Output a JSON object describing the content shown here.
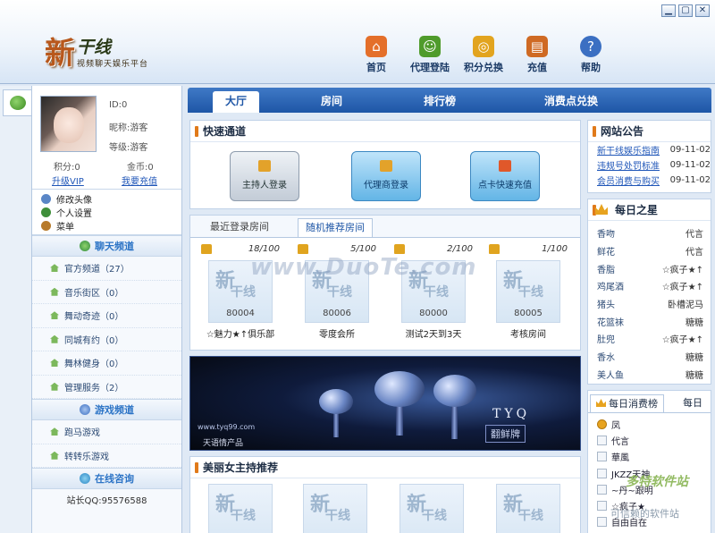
{
  "window": {
    "controls": [
      "▁",
      "▢",
      "✕"
    ]
  },
  "brand": {
    "logo_char": "新",
    "logo_name": "干线",
    "slogan": "视频聊天娱乐平台"
  },
  "topnav": [
    {
      "label": "首页",
      "icon": "home-icon",
      "color": "#e46f2a"
    },
    {
      "label": "代理登陆",
      "icon": "person-icon",
      "color": "#4f9b2b"
    },
    {
      "label": "积分兑换",
      "icon": "coins-icon",
      "color": "#e2a41f"
    },
    {
      "label": "充值",
      "icon": "card-icon",
      "color": "#cf6a24"
    },
    {
      "label": "帮助",
      "icon": "help-icon",
      "color": "#3b6fc2"
    }
  ],
  "user": {
    "id_text": "ID:0",
    "nickname_text": "昵称:游客",
    "level_text": "等级:游客",
    "points_text": "积分:0",
    "gold_text": "金币:0",
    "upgrade_vip": "升级VIP",
    "recharge": "我要充值"
  },
  "user_menu": [
    {
      "label": "修改头像",
      "icon": "users-icon",
      "color": "#5a86c6"
    },
    {
      "label": "个人设置",
      "icon": "gear-icon",
      "color": "#3f8f3a"
    },
    {
      "label": "菜单",
      "icon": "tools-icon",
      "color": "#b77a2a"
    }
  ],
  "chat_section": {
    "title": "聊天频道",
    "items": [
      "官方频道（27）",
      "音乐街区（0）",
      "舞动奇迹（0）",
      "同城有约（0）",
      "舞林健身（0）",
      "管理服务（2）"
    ]
  },
  "game_section": {
    "title": "游戏频道",
    "items": [
      "跑马游戏",
      "转转乐游戏"
    ]
  },
  "consult_section": {
    "title": "在线咨询",
    "contact": "站长QQ:95576588"
  },
  "main_tabs": [
    "大厅",
    "房间",
    "排行榜",
    "消费点兑换"
  ],
  "quick": {
    "title": "快速通道",
    "buttons": [
      "主持人登录",
      "代理商登录",
      "点卡快速充值"
    ]
  },
  "rooms": {
    "tabs": [
      "最近登录房间",
      "随机推荐房间"
    ],
    "items": [
      {
        "count": "18/100",
        "id": "80004",
        "name": "☆魅力★↑俱乐部"
      },
      {
        "count": "5/100",
        "id": "80006",
        "name": "零度会所"
      },
      {
        "count": "2/100",
        "id": "80000",
        "name": "测试2天到3天"
      },
      {
        "count": "1/100",
        "id": "80005",
        "name": "考核房间"
      }
    ]
  },
  "banner": {
    "brand": "TYQ",
    "tag": "翻鲜牌",
    "url": "www.tyq99.com",
    "footer": "天语情产品"
  },
  "hosts": {
    "title": "美丽女主持推荐",
    "count": 4
  },
  "notices": {
    "title": "网站公告",
    "items": [
      {
        "title": "新干线娱乐指南",
        "date": "09-11-02"
      },
      {
        "title": "违规号处罚标准",
        "date": "09-11-02"
      },
      {
        "title": "会员消费与购买",
        "date": "09-11-02"
      }
    ]
  },
  "daily_star": {
    "title": "每日之星",
    "rows": [
      [
        "香吻",
        "代言"
      ],
      [
        "鲜花",
        "代言"
      ],
      [
        "香脂",
        "☆疯子★↑"
      ],
      [
        "鸡尾酒",
        "☆疯子★↑"
      ],
      [
        "猪头",
        "卧槽泥马"
      ],
      [
        "花篮袜",
        "糖糖"
      ],
      [
        "肚兜",
        "☆疯子★↑"
      ],
      [
        "香水",
        "糖糖"
      ],
      [
        "美人鱼",
        "糖糖"
      ]
    ]
  },
  "daily_consume": {
    "tabs": [
      "每日消费榜",
      "每日"
    ],
    "items": [
      "凤",
      "代言",
      "華風",
      "JKZZ天神",
      "~丹~跟明",
      "☆疯子★",
      "自由自在"
    ]
  },
  "watermarks": {
    "center": "www.DuoTe.com",
    "corner_title": "多特软件站",
    "corner_sub": "可信赖的软件站"
  }
}
